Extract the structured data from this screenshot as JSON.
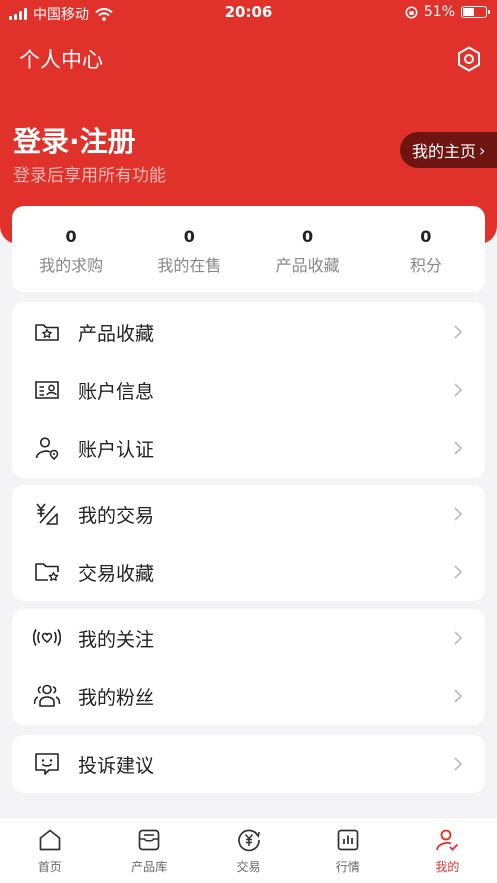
{
  "status_bar": {
    "carrier": "中国移动",
    "time": "20:06",
    "battery": "51%",
    "battery_level": 0.51
  },
  "header": {
    "title": "个人中心",
    "login_title": "登录·注册",
    "login_subtitle": "登录后享用所有功能",
    "homepage_label": "我的主页",
    "homepage_chevron": "›"
  },
  "stats": [
    {
      "value": "0",
      "label": "我的求购"
    },
    {
      "value": "0",
      "label": "我的在售"
    },
    {
      "value": "0",
      "label": "产品收藏"
    },
    {
      "value": "0",
      "label": "积分"
    }
  ],
  "menu": {
    "group1": [
      {
        "label": "产品收藏",
        "icon": "folder-star-icon"
      },
      {
        "label": "账户信息",
        "icon": "id-card-icon"
      },
      {
        "label": "账户认证",
        "icon": "user-verify-icon"
      }
    ],
    "group2": [
      {
        "label": "我的交易",
        "icon": "yuan-trade-icon"
      },
      {
        "label": "交易收藏",
        "icon": "folder-star-icon"
      }
    ],
    "group3": [
      {
        "label": "我的关注",
        "icon": "heart-signal-icon"
      },
      {
        "label": "我的粉丝",
        "icon": "users-icon"
      }
    ],
    "group4": [
      {
        "label": "投诉建议",
        "icon": "feedback-icon"
      }
    ]
  },
  "tabbar": [
    {
      "label": "首页",
      "icon": "home-icon"
    },
    {
      "label": "产品库",
      "icon": "product-library-icon"
    },
    {
      "label": "交易",
      "icon": "trade-icon"
    },
    {
      "label": "行情",
      "icon": "market-chart-icon"
    },
    {
      "label": "我的",
      "icon": "profile-icon",
      "active": true
    }
  ],
  "colors": {
    "brand": "#e0322b",
    "homepage_button": "#6e1512",
    "background": "#f4f4f6"
  }
}
